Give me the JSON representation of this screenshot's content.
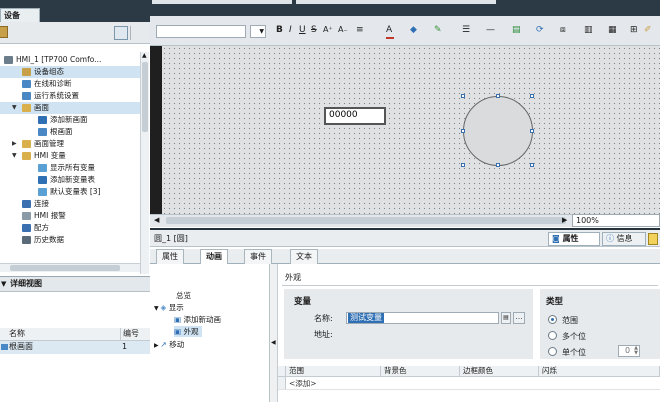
{
  "left_panel": {
    "tab_label": "设备",
    "tree": [
      {
        "label": "HMI_1 [TP700 Comfo...",
        "level": 1,
        "expanded": true,
        "icon": "hmi-device-icon"
      },
      {
        "label": "设备组态",
        "level": 2,
        "icon": "device-config-icon"
      },
      {
        "label": "在线和诊断",
        "level": 2,
        "icon": "online-diagnostics-icon"
      },
      {
        "label": "运行系统设置",
        "level": 2,
        "icon": "runtime-settings-icon"
      },
      {
        "label": "画面",
        "level": 2,
        "expanded": true,
        "icon": "folder-icon"
      },
      {
        "label": "添加新画面",
        "level": 3,
        "icon": "add-screen-icon"
      },
      {
        "label": "根画面",
        "level": 3,
        "icon": "screen-icon"
      },
      {
        "label": "画面管理",
        "level": 2,
        "expanded": false,
        "icon": "folder-icon"
      },
      {
        "label": "HMI 变量",
        "level": 2,
        "expanded": true,
        "icon": "folder-icon"
      },
      {
        "label": "显示所有变量",
        "level": 3,
        "icon": "tags-icon"
      },
      {
        "label": "添加新变量表",
        "level": 3,
        "icon": "add-tagtable-icon"
      },
      {
        "label": "默认变量表 [3]",
        "level": 3,
        "icon": "tagtable-icon"
      },
      {
        "label": "连接",
        "level": 2,
        "icon": "connection-icon"
      },
      {
        "label": "HMI 报警",
        "level": 2,
        "icon": "alarm-icon"
      },
      {
        "label": "配方",
        "level": 2,
        "icon": "recipe-icon"
      },
      {
        "label": "历史数据",
        "level": 2,
        "icon": "history-icon"
      }
    ],
    "detail_view": {
      "title": "详细视图",
      "columns": [
        "名称",
        "编号"
      ],
      "rows": [
        {
          "name": "根画面",
          "number": "1"
        }
      ]
    }
  },
  "canvas": {
    "io_field_value": "00000",
    "zoom": "100%"
  },
  "properties": {
    "title": "圆_1 [圆]",
    "tabs_right": [
      "属性",
      "信息"
    ],
    "tabs": [
      "属性",
      "动画",
      "事件",
      "文本"
    ],
    "active_tab": "动画",
    "nav": [
      {
        "label": "总览",
        "level": 1
      },
      {
        "label": "显示",
        "level": 1,
        "expanded": true
      },
      {
        "label": "添加新动画",
        "level": 2
      },
      {
        "label": "外观",
        "level": 2,
        "selected": true
      },
      {
        "label": "移动",
        "level": 1,
        "expanded": false
      }
    ],
    "section_title": "外观",
    "variable_group": {
      "title": "变量",
      "name_label": "名称:",
      "name_value": "测试变量",
      "address_label": "地址:"
    },
    "type_group": {
      "title": "类型",
      "options": [
        "范围",
        "多个位",
        "单个位"
      ],
      "selected": "范围",
      "bit_value": "0"
    },
    "grid": {
      "columns": [
        "范围",
        "背景色",
        "边框颜色",
        "闪烁"
      ],
      "add_row": "<添加>"
    }
  },
  "colors": {
    "selection": "#cfe3f2",
    "header_dark": "#2b3a45",
    "accent_blue": "#3a6fb0"
  }
}
